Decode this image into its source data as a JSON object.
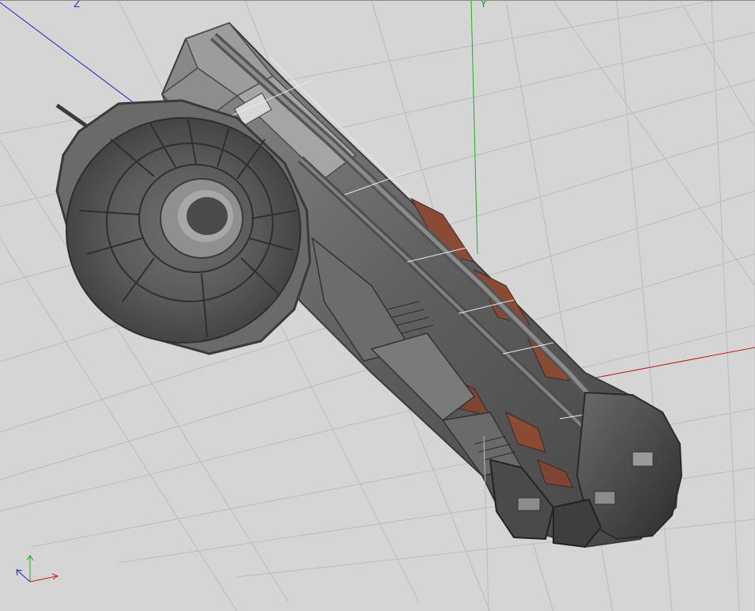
{
  "viewport": {
    "background": "#d5d5d5",
    "grid_color": "#bdbdbd"
  },
  "axes": {
    "z_label": "Z",
    "y_label": "Y",
    "x_color": "#c02020",
    "y_color": "#18b018",
    "z_color": "#2020d0"
  },
  "model": {
    "icon": "spaceship-model",
    "hull_color": "#7a7a7a",
    "panel_rust_color": "#8a4a34"
  },
  "gizmo": {
    "icon": "orientation-gizmo-icon"
  }
}
